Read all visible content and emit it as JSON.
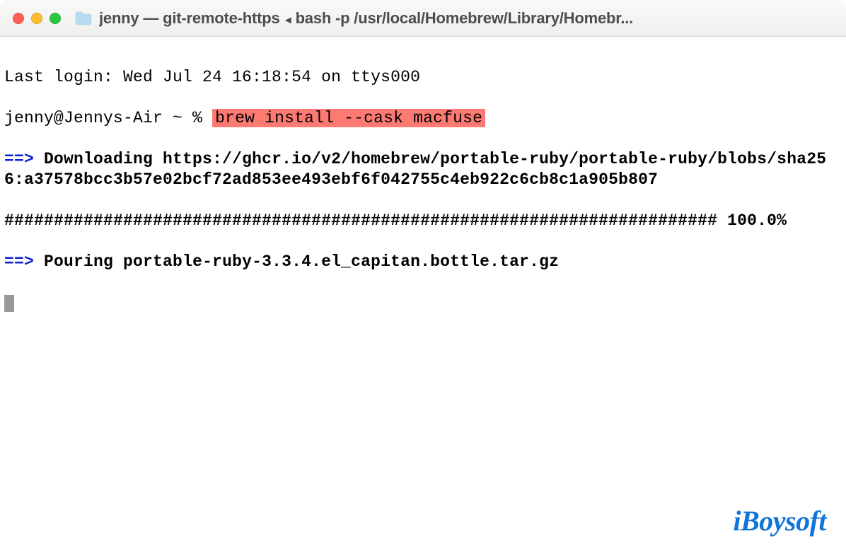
{
  "window": {
    "title_prefix": "jenny",
    "title_process": "git-remote-https",
    "title_rest": "bash -p /usr/local/Homebrew/Library/Homebr..."
  },
  "terminal": {
    "last_login": "Last login: Wed Jul 24 16:18:54 on ttys000",
    "prompt": "jenny@Jennys-Air ~ % ",
    "command": "brew install --cask macfuse",
    "arrow": "==>",
    "downloading_label": " Downloading ",
    "downloading_url": "https://ghcr.io/v2/homebrew/portable-ruby/portable-ruby/blobs/sha256:a37578bcc3b57e02bcf72ad853ee493ebf6f042755c4eb922c6cb8c1a905b807",
    "progress_bar": "########################################################################",
    "progress_pct": " 100.0%",
    "pouring_label": " Pouring ",
    "pouring_file": "portable-ruby-3.3.4.el_capitan.bottle.tar.gz"
  },
  "watermark": "iBoysoft"
}
